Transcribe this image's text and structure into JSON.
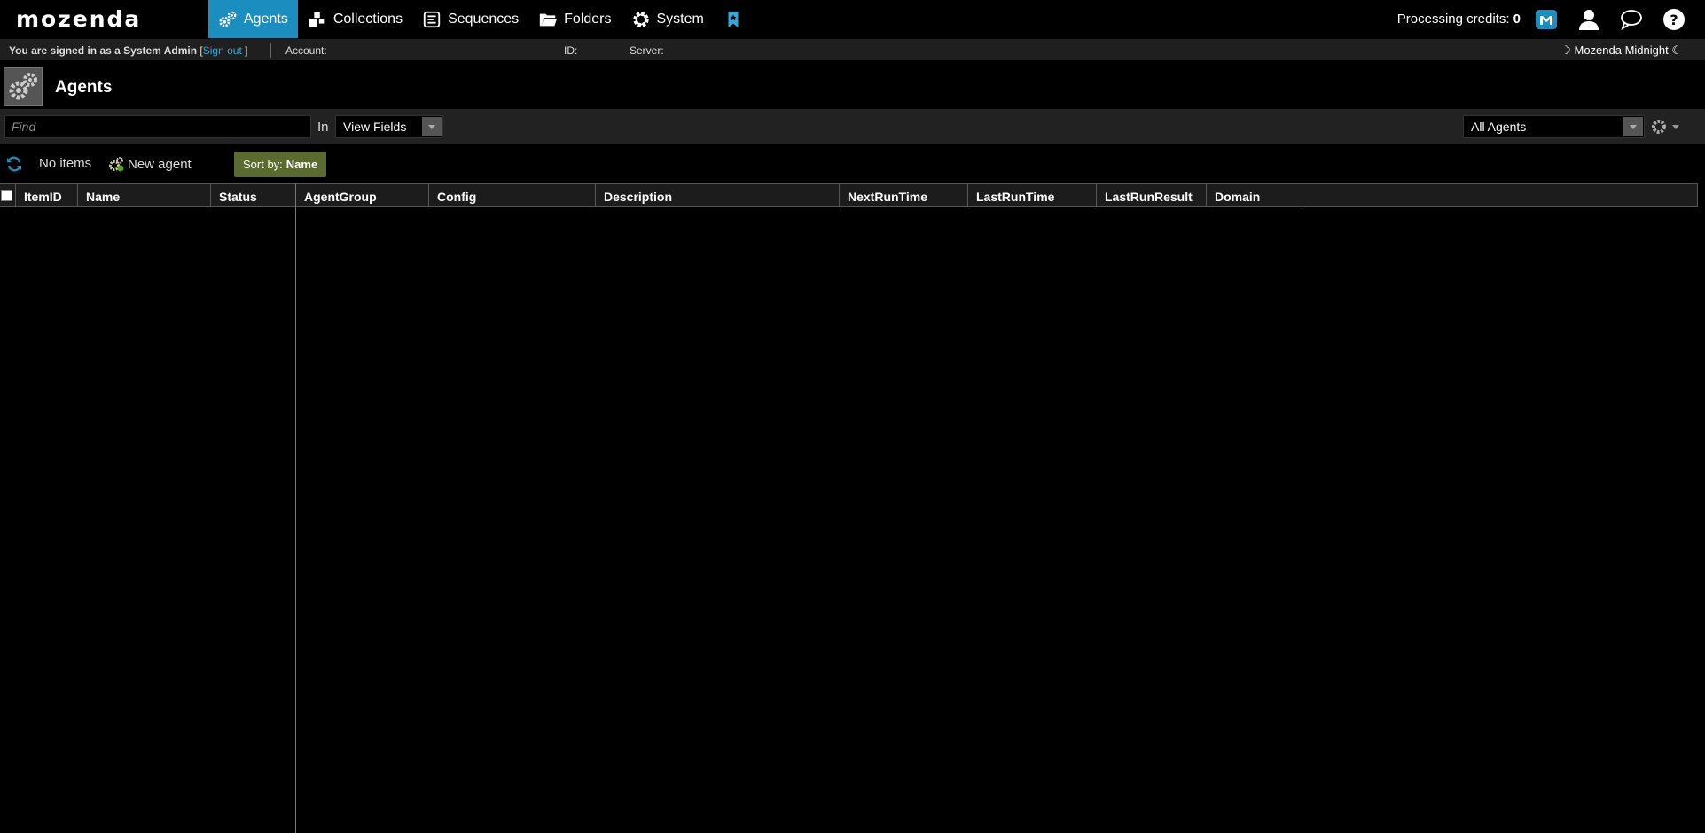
{
  "app": {
    "logo": "mozenda"
  },
  "nav": {
    "items": [
      {
        "label": "Agents",
        "icon": "agents-gears-icon",
        "active": true
      },
      {
        "label": "Collections",
        "icon": "collections-icon",
        "active": false
      },
      {
        "label": "Sequences",
        "icon": "sequences-icon",
        "active": false
      },
      {
        "label": "Folders",
        "icon": "folders-icon",
        "active": false
      },
      {
        "label": "System",
        "icon": "system-gear-icon",
        "active": false
      }
    ],
    "bookmark_icon": "bookmark-icon"
  },
  "header_right": {
    "credits_label": "Processing credits:",
    "credits_value": "0"
  },
  "infobar": {
    "signed_in_text": "You are signed in as a System Admin",
    "sign_out_open": "[",
    "sign_out_label": "Sign out",
    "sign_out_close": "]",
    "account_label": "Account:",
    "id_label": "ID:",
    "server_label": "Server:",
    "theme_label": "☽ Mozenda Midnight ☾"
  },
  "page": {
    "title": "Agents"
  },
  "filter": {
    "find_placeholder": "Find",
    "in_label": "In",
    "fields_select": "View Fields",
    "scope_select": "All Agents"
  },
  "toolbar": {
    "count_text": "No items",
    "new_agent_label": "New agent",
    "sort_label": "Sort by:",
    "sort_value": "Name"
  },
  "grid": {
    "columns": [
      "ItemID",
      "Name",
      "Status",
      "AgentGroup",
      "Config",
      "Description",
      "NextRunTime",
      "LastRunTime",
      "LastRunResult",
      "Domain"
    ]
  },
  "colors": {
    "active_nav": "#1b8dbf",
    "link": "#34a8d9",
    "sort_button": "#5b6b2f"
  }
}
